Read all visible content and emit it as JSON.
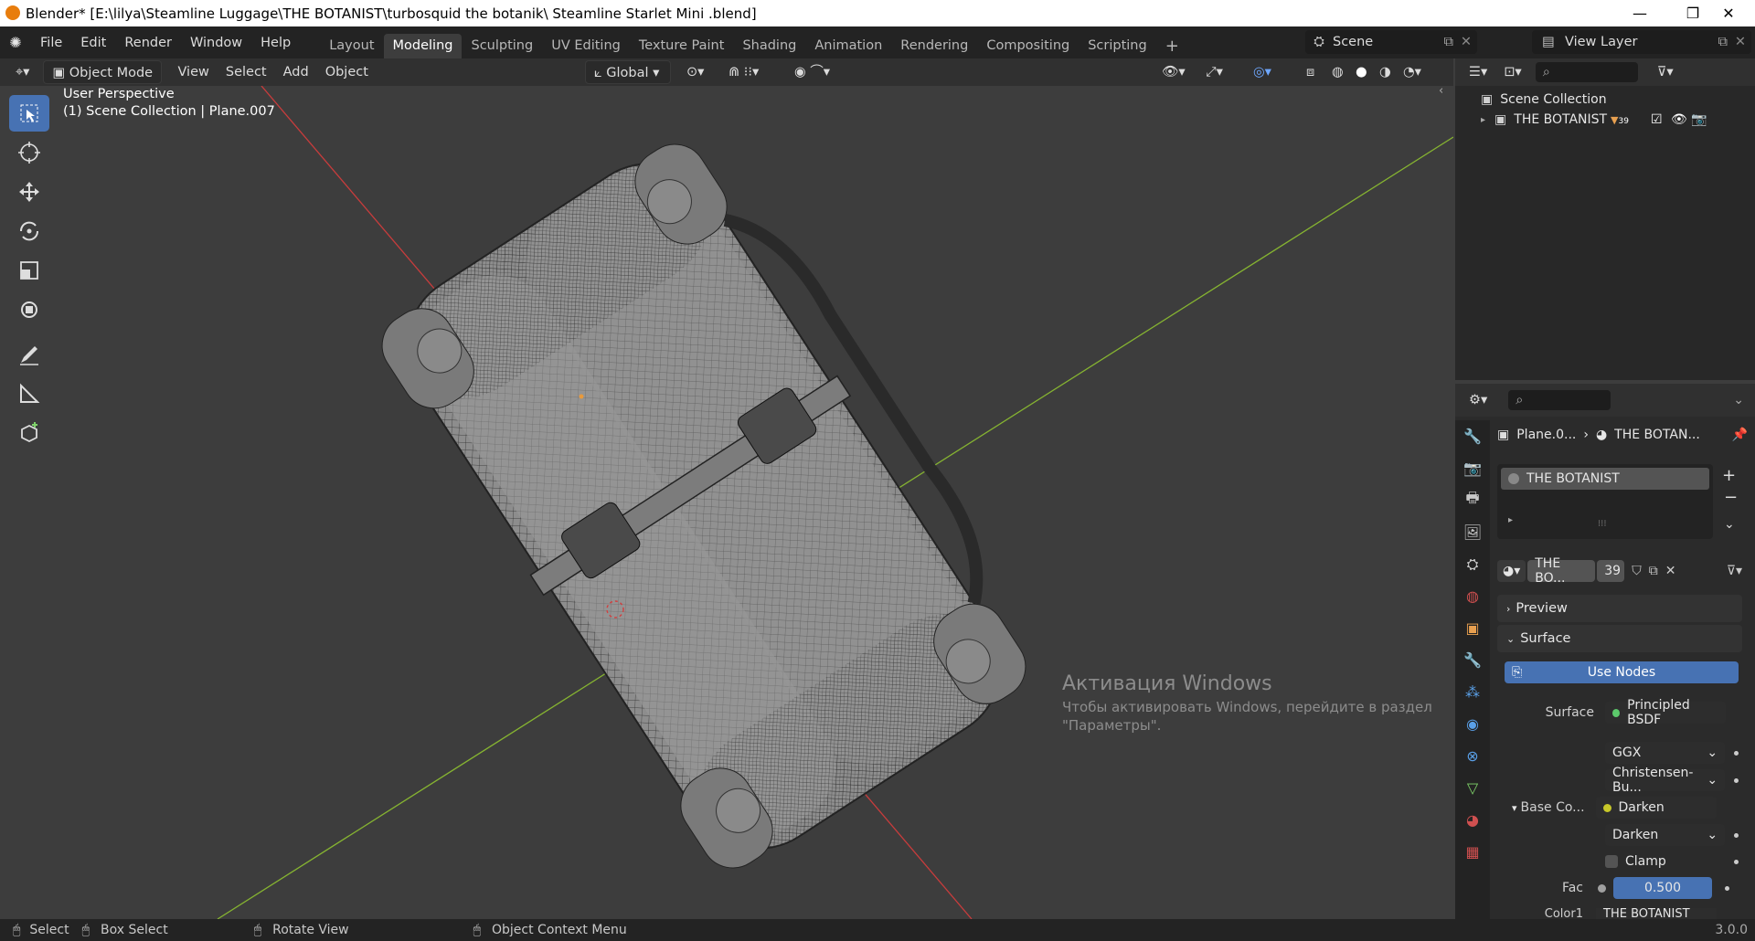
{
  "window": {
    "title": "Blender* [E:\\lilya\\Steamline Luggage\\THE BOTANIST\\turbosquid the botanik\\ Steamline Starlet Mini .blend]",
    "controls": [
      "—",
      "❐",
      "✕"
    ]
  },
  "menu": [
    "File",
    "Edit",
    "Render",
    "Window",
    "Help"
  ],
  "workspaces": [
    {
      "label": "Layout",
      "active": false
    },
    {
      "label": "Modeling",
      "active": true
    },
    {
      "label": "Sculpting",
      "active": false
    },
    {
      "label": "UV Editing",
      "active": false
    },
    {
      "label": "Texture Paint",
      "active": false
    },
    {
      "label": "Shading",
      "active": false
    },
    {
      "label": "Animation",
      "active": false
    },
    {
      "label": "Rendering",
      "active": false
    },
    {
      "label": "Compositing",
      "active": false
    },
    {
      "label": "Scripting",
      "active": false
    }
  ],
  "scene": {
    "name": "Scene",
    "view_layer": "View Layer"
  },
  "viewport_header": {
    "mode": "Object Mode",
    "menus": [
      "View",
      "Select",
      "Add",
      "Object"
    ],
    "transform_orientation": "Global"
  },
  "viewport": {
    "perspective_label": "User Perspective",
    "collection_label": "(1) Scene Collection | Plane.007",
    "axis_colors": {
      "x": "#c83c3c",
      "y": "#86b431"
    }
  },
  "tools": [
    {
      "name": "select-box-icon",
      "active": true
    },
    {
      "name": "cursor-icon",
      "active": false
    },
    {
      "name": "move-icon",
      "active": false
    },
    {
      "name": "rotate-icon",
      "active": false
    },
    {
      "name": "scale-icon",
      "active": false
    },
    {
      "name": "transform-icon",
      "active": false
    },
    {
      "name": "annotate-icon",
      "active": false
    },
    {
      "name": "measure-icon",
      "active": false
    },
    {
      "name": "add-cube-icon",
      "active": false
    }
  ],
  "outliner": {
    "root": "Scene Collection",
    "items": [
      {
        "label": "THE BOTANIST",
        "badge": "39"
      }
    ]
  },
  "properties": {
    "breadcrumb": {
      "object": "Plane.0...",
      "material": "THE BOTAN..."
    },
    "material_slot": "THE BOTANIST",
    "material_name": "THE BO...",
    "user_count": "39",
    "sections": {
      "preview": "Preview",
      "surface": "Surface"
    },
    "use_nodes_label": "Use Nodes",
    "surface_label": "Surface",
    "surface_value": "Principled BSDF",
    "distribution": "GGX",
    "subsurface": "Christensen-Bu...",
    "base_color_label": "Base Co...",
    "base_color_value": "Darken",
    "blend_mode": "Darken",
    "clamp_label": "Clamp",
    "fac_label": "Fac",
    "fac_value": "0.500",
    "next_label": "Color1",
    "next_value": "THE BOTANIST"
  },
  "watermark": {
    "line1": "Активация Windows",
    "line2": "Чтобы активировать Windows, перейдите в раздел",
    "line3": "\"Параметры\"."
  },
  "status": {
    "items": [
      "Select",
      "Box Select",
      "Rotate View",
      "Object Context Menu"
    ],
    "version": "3.0.0"
  }
}
